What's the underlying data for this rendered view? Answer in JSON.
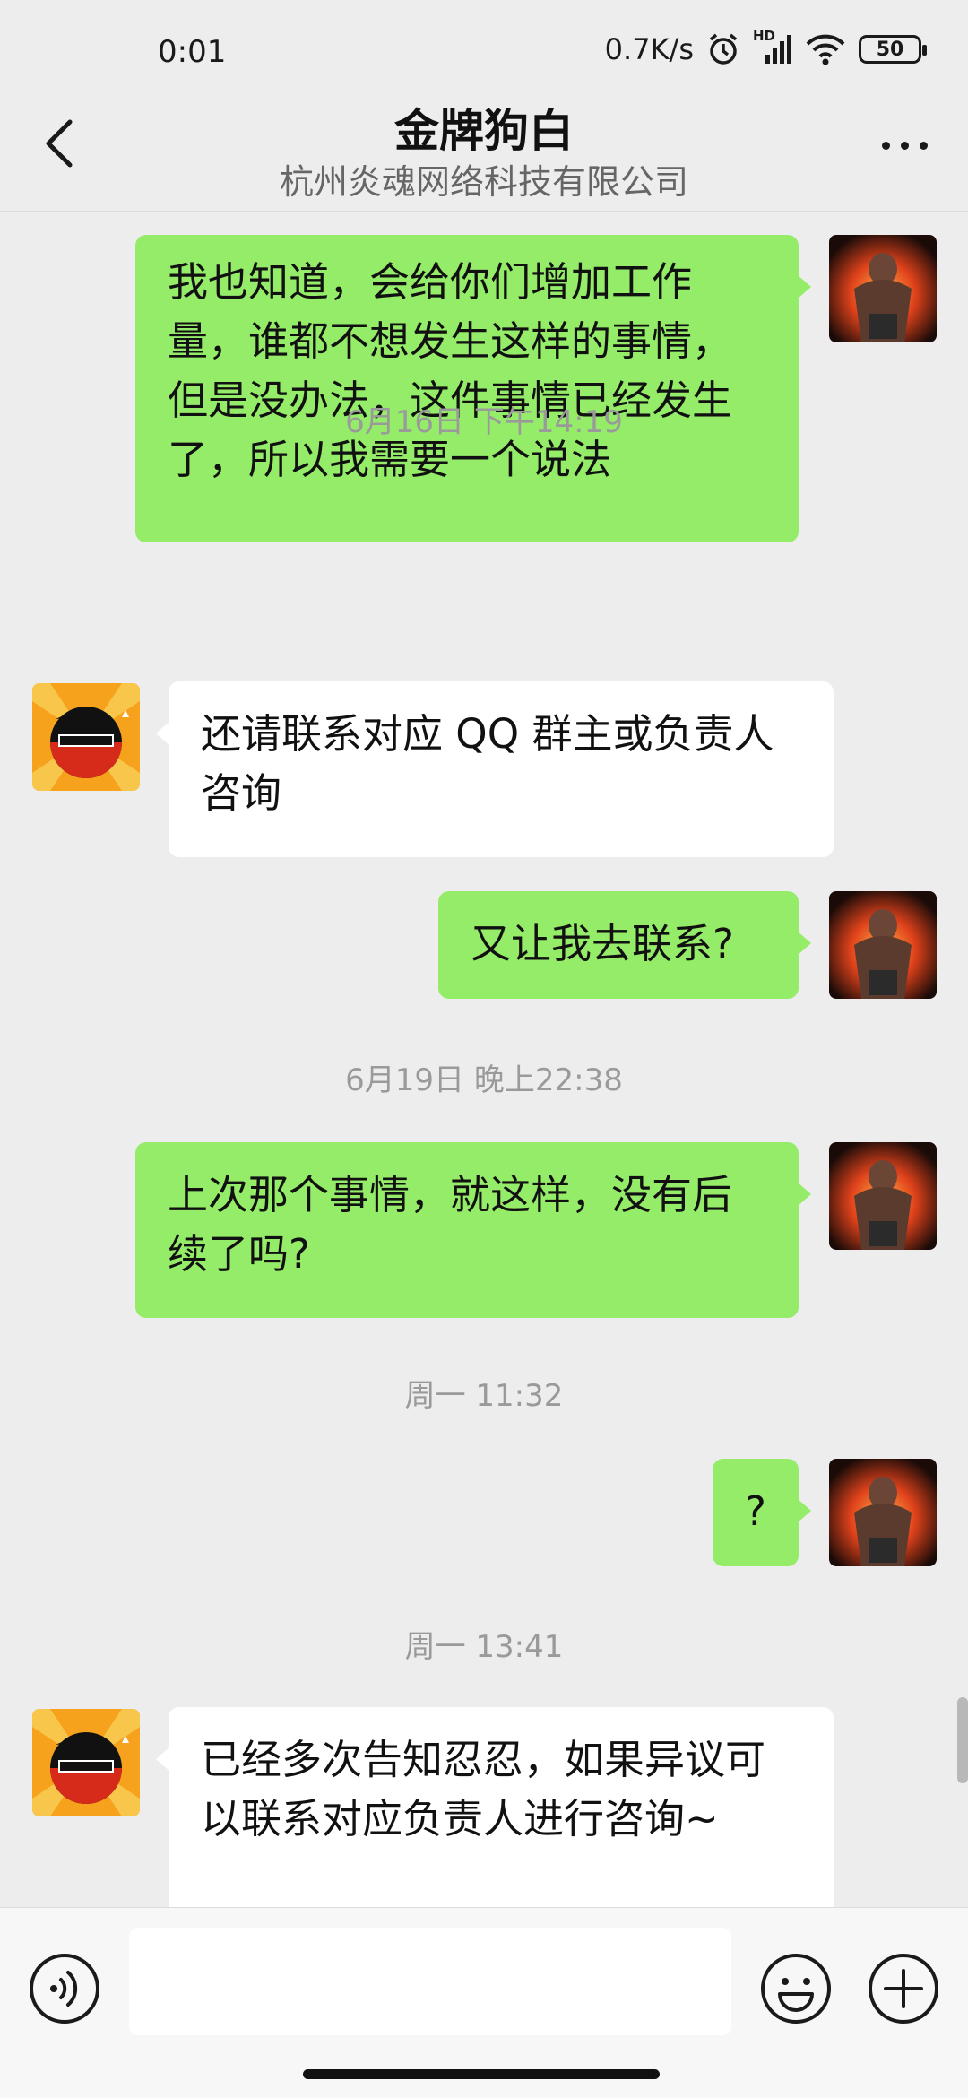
{
  "status_bar": {
    "time": "0:01",
    "net_speed": "0.7K/s",
    "hd_label": "HD",
    "battery": "50"
  },
  "header": {
    "title": "金牌狗白",
    "subtitle": "杭州炎魂网络科技有限公司"
  },
  "messages": [
    {
      "kind": "me",
      "text": "我也知道，会给你们增加工作量，谁都不想发生这样的事情，但是没办法，这件事情已经发生了，所以我需要一个说法"
    },
    {
      "kind": "time",
      "text": "6月16日 下午14:19"
    },
    {
      "kind": "them",
      "text": "还请联系对应 QQ 群主或负责人咨询"
    },
    {
      "kind": "me",
      "text": "又让我去联系?"
    },
    {
      "kind": "time",
      "text": "6月19日 晚上22:38"
    },
    {
      "kind": "me",
      "text": "上次那个事情，就这样，没有后续了吗?"
    },
    {
      "kind": "time",
      "text": "周一 11:32"
    },
    {
      "kind": "me",
      "text": "?"
    },
    {
      "kind": "time",
      "text": "周一 13:41"
    },
    {
      "kind": "them",
      "text": "已经多次告知忍忍，如果异议可以联系对应负责人进行咨询~"
    }
  ],
  "colors": {
    "my_bubble": "#95ec69",
    "their_bubble": "#ffffff",
    "background": "#ededed"
  },
  "icons": {
    "back": "chevron-left-icon",
    "more": "more-dots-icon",
    "voice": "voice-icon",
    "emoji": "emoji-icon",
    "plus": "plus-icon"
  }
}
